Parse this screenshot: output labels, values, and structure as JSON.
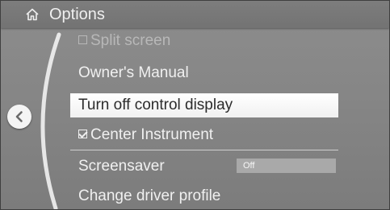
{
  "header": {
    "title": "Options",
    "home_icon": "home-icon"
  },
  "back_icon": "chevron-left-icon",
  "menu": {
    "items": [
      {
        "label": "Split screen",
        "checkbox": "unchecked",
        "state": "disabled"
      },
      {
        "label": "Owner's Manual",
        "state": "normal"
      },
      {
        "label": "Turn off control display",
        "state": "selected"
      },
      {
        "label": "Center Instrument",
        "checkbox": "checked",
        "state": "normal"
      },
      {
        "label": "Screensaver",
        "value": "Off",
        "state": "normal"
      },
      {
        "label": "Change driver profile",
        "state": "normal"
      }
    ]
  },
  "colors": {
    "background": "#858585",
    "text": "#f0f0f0",
    "selected_background": "#ffffff",
    "selected_text": "#2c2c2c"
  }
}
